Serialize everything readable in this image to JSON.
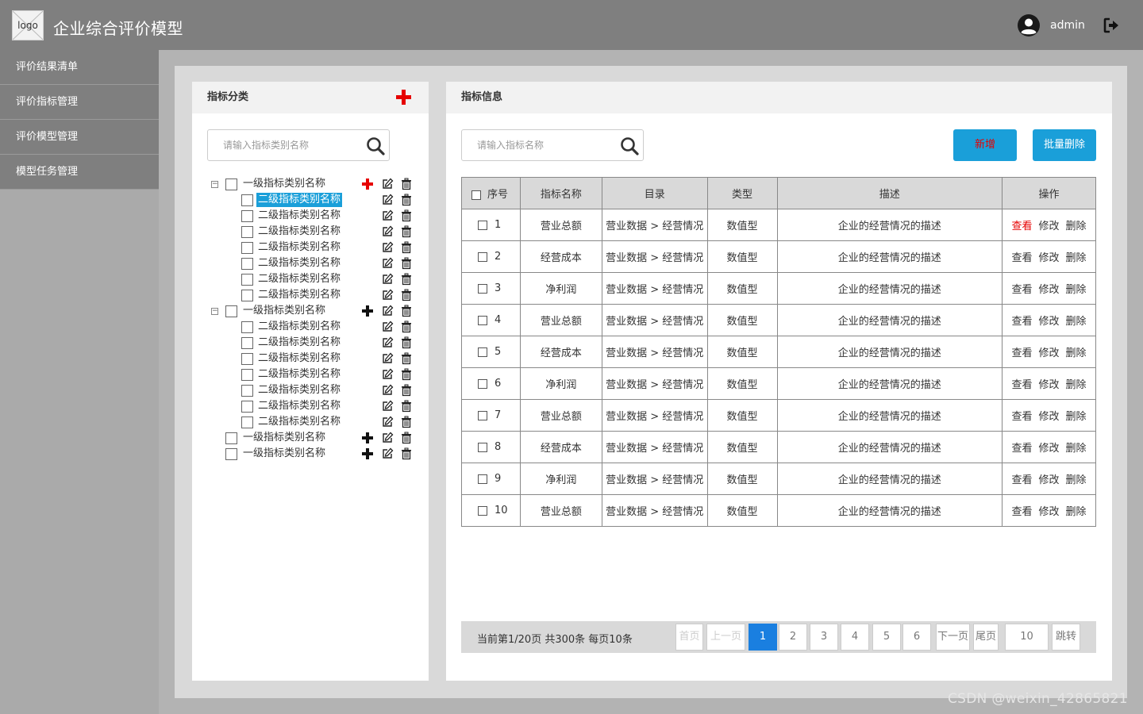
{
  "header": {
    "logo_text": "logo",
    "app_title": "企业综合评价模型",
    "username": "admin"
  },
  "sidebar": {
    "items": [
      {
        "label": "评价结果清单"
      },
      {
        "label": "评价指标管理"
      },
      {
        "label": "评价模型管理"
      },
      {
        "label": "模型任务管理"
      }
    ]
  },
  "category_panel": {
    "title": "指标分类",
    "search_placeholder": "请输入指标类别名称",
    "tree": [
      {
        "label": "一级指标类别名称",
        "expanded": true,
        "children": [
          {
            "label": "二级指标类别名称",
            "selected": true
          },
          {
            "label": "二级指标类别名称"
          },
          {
            "label": "二级指标类别名称"
          },
          {
            "label": "二级指标类别名称"
          },
          {
            "label": "二级指标类别名称"
          },
          {
            "label": "二级指标类别名称"
          },
          {
            "label": "二级指标类别名称"
          }
        ]
      },
      {
        "label": "一级指标类别名称",
        "expanded": true,
        "children": [
          {
            "label": "二级指标类别名称"
          },
          {
            "label": "二级指标类别名称"
          },
          {
            "label": "二级指标类别名称"
          },
          {
            "label": "二级指标类别名称"
          },
          {
            "label": "二级指标类别名称"
          },
          {
            "label": "二级指标类别名称"
          },
          {
            "label": "二级指标类别名称"
          }
        ]
      },
      {
        "label": "一级指标类别名称",
        "expanded": false,
        "children": []
      },
      {
        "label": "一级指标类别名称",
        "expanded": false,
        "children": []
      }
    ]
  },
  "info_panel": {
    "title": "指标信息",
    "search_placeholder": "请输入指标名称",
    "add_label": "新增",
    "batch_delete_label": "批量删除",
    "columns": [
      "序号",
      "指标名称",
      "目录",
      "类型",
      "描述",
      "操作"
    ],
    "actions": {
      "view": "查看",
      "edit": "修改",
      "delete": "删除"
    },
    "rows": [
      {
        "idx": "1",
        "name": "营业总额",
        "dir": "营业数据 > 经营情况",
        "type": "数值型",
        "desc": "企业的经营情况的描述",
        "view_active": true
      },
      {
        "idx": "2",
        "name": "经营成本",
        "dir": "营业数据 > 经营情况",
        "type": "数值型",
        "desc": "企业的经营情况的描述"
      },
      {
        "idx": "3",
        "name": "净利润",
        "dir": "营业数据 > 经营情况",
        "type": "数值型",
        "desc": "企业的经营情况的描述"
      },
      {
        "idx": "4",
        "name": "营业总额",
        "dir": "营业数据 > 经营情况",
        "type": "数值型",
        "desc": "企业的经营情况的描述"
      },
      {
        "idx": "5",
        "name": "经营成本",
        "dir": "营业数据 > 经营情况",
        "type": "数值型",
        "desc": "企业的经营情况的描述"
      },
      {
        "idx": "6",
        "name": "净利润",
        "dir": "营业数据 > 经营情况",
        "type": "数值型",
        "desc": "企业的经营情况的描述"
      },
      {
        "idx": "7",
        "name": "营业总额",
        "dir": "营业数据 > 经营情况",
        "type": "数值型",
        "desc": "企业的经营情况的描述"
      },
      {
        "idx": "8",
        "name": "经营成本",
        "dir": "营业数据 > 经营情况",
        "type": "数值型",
        "desc": "企业的经营情况的描述"
      },
      {
        "idx": "9",
        "name": "净利润",
        "dir": "营业数据 > 经营情况",
        "type": "数值型",
        "desc": "企业的经营情况的描述"
      },
      {
        "idx": "10",
        "name": "营业总额",
        "dir": "营业数据 > 经营情况",
        "type": "数值型",
        "desc": "企业的经营情况的描述"
      }
    ],
    "pager": {
      "info": "当前第1/20页  共300条  每页10条",
      "first": "首页",
      "prev": "上一页",
      "pages": [
        "1",
        "2",
        "3",
        "4",
        "5",
        "6"
      ],
      "current": "1",
      "next": "下一页",
      "last": "尾页",
      "jump_value": "10",
      "jump_label": "跳转"
    }
  },
  "watermark": "CSDN @weixin_42865821",
  "colors": {
    "header_bg": "#7f7f7f",
    "accent": "#1a9fd9",
    "current_page": "#1a7fe0",
    "add_red": "#e60000"
  }
}
